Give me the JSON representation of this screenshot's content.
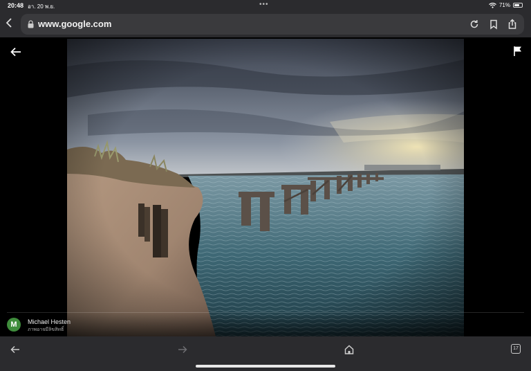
{
  "status_bar": {
    "time": "20:48",
    "date": "อา. 20 พ.ย.",
    "battery": "71%",
    "battery_level": 0.71
  },
  "browser": {
    "url": "www.google.com"
  },
  "photo": {
    "author_initial": "M",
    "author_name": "Michael Hesten",
    "author_subtitle": "ภาพอาจมีลิขสิทธิ์",
    "avatar_color": "#3f8d3c"
  },
  "toolbar": {
    "tab_count": "17"
  },
  "colors": {
    "chrome_bg": "#2b2b2e",
    "url_pill": "#3a3a3d"
  }
}
